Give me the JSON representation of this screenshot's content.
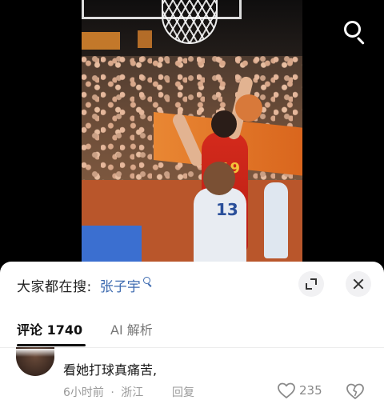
{
  "video": {
    "player_number_red": "19",
    "player_number_white": "13"
  },
  "top_actions": {
    "search_icon": "search-icon"
  },
  "suggest": {
    "label": "大家都在搜:",
    "term": "张子宇",
    "icon": "search-icon"
  },
  "sheet_actions": {
    "expand_icon": "expand-icon",
    "close_icon": "close-icon"
  },
  "tabs": [
    {
      "label": "评论 1740",
      "active": true
    },
    {
      "label": "AI 解析",
      "active": false
    }
  ],
  "comment": {
    "text": "看她打球真痛苦,",
    "time": "6小时前",
    "separator": "·",
    "location": "浙江",
    "reply_label": "回复",
    "like_count": "235",
    "like_icon": "heart-icon",
    "dislike_icon": "broken-heart-icon"
  },
  "colors": {
    "link": "#3e6bb0",
    "muted": "#9a9a9a",
    "sheet_bg": "#ffffff"
  }
}
